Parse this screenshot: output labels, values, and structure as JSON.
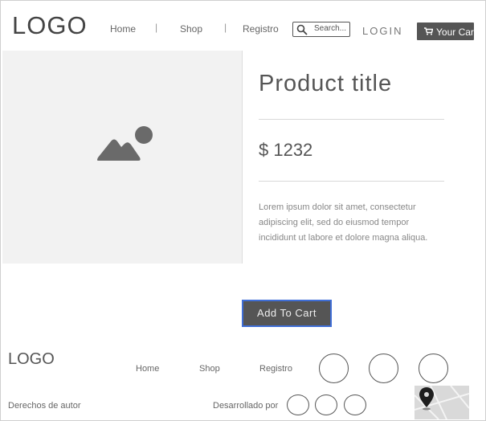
{
  "header": {
    "logo": "LOGO",
    "nav": [
      "Home",
      "Shop",
      "Registro"
    ],
    "separator": "|",
    "search_placeholder": "Search...",
    "login": "LOGIN",
    "cart_label": "Your Car"
  },
  "product": {
    "title": "Product title",
    "price": "$ 1232",
    "description": "Lorem ipsum dolor sit amet, consectetur adipiscing elit, sed do eiusmod tempor incididunt ut labore et dolore magna aliqua.",
    "add_to_cart": "Add To Cart"
  },
  "footer": {
    "logo": "LOGO",
    "nav": [
      "Home",
      "Shop",
      "Registro"
    ],
    "copyright": "Derechos de autor",
    "developed_by": "Desarrollado por"
  },
  "colors": {
    "button_dark": "#555555",
    "focus_outline": "#3f6ed6",
    "image_placeholder": "#f2f2f2"
  },
  "icons": [
    "search-icon",
    "cart-icon",
    "image-placeholder-icon",
    "map-pin-icon"
  ]
}
